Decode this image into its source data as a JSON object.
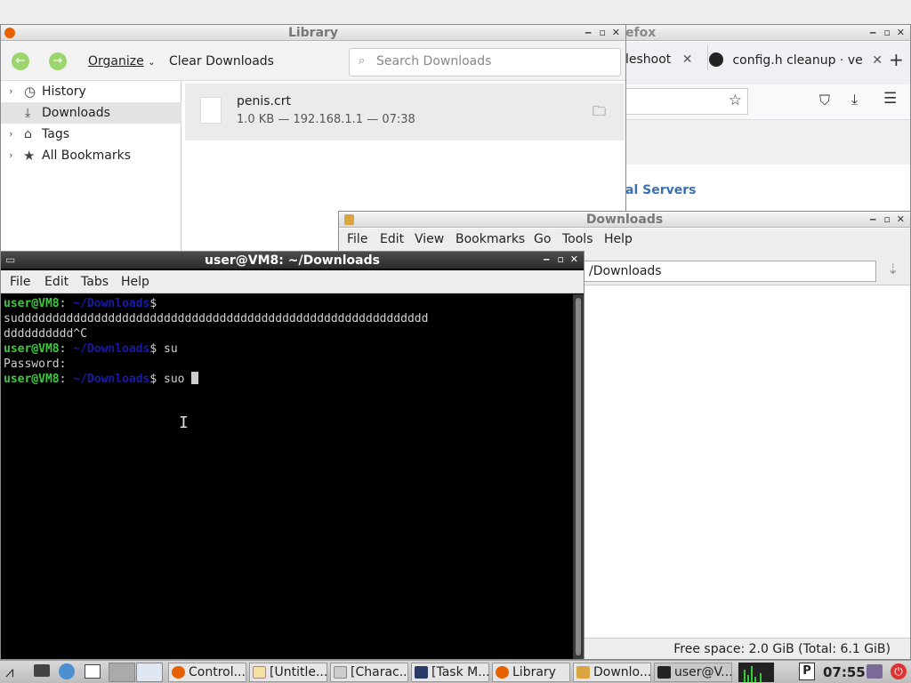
{
  "firefox": {
    "title_fragment": "efox",
    "tab1_label": "leshoot",
    "tab2_label": "config.h cleanup · ve",
    "link_text": "al Servers"
  },
  "library": {
    "title": "Library",
    "organize_label": "Organize",
    "clear_label": "Clear Downloads",
    "search_placeholder": "Search Downloads",
    "sidebar": [
      {
        "label": "History"
      },
      {
        "label": "Downloads"
      },
      {
        "label": "Tags"
      },
      {
        "label": "All Bookmarks"
      }
    ],
    "download": {
      "filename": "penis.crt",
      "details": "1.0 KB — 192.168.1.1 — 07:38"
    }
  },
  "filemanager": {
    "title": "Downloads",
    "menu": [
      "File",
      "Edit",
      "View",
      "Bookmarks",
      "Go",
      "Tools",
      "Help"
    ],
    "path": "/Downloads",
    "status": "Free space: 2.0 GiB (Total: 6.1 GiB)"
  },
  "terminal": {
    "title": "user@VM8: ~/Downloads",
    "menu": [
      "File",
      "Edit",
      "Tabs",
      "Help"
    ],
    "prompt_user": "user@VM8",
    "prompt_sep": ":",
    "prompt_path": " ~/Downloads",
    "prompt_end": "$ ",
    "lines": [
      "suddddddddddddddddddddddddddddddddddddddddddddddddddddddddddd",
      "dddddddddd^C",
      "su",
      "Password:",
      "suo "
    ]
  },
  "taskbar": {
    "tasks": [
      "Control...",
      "[Untitle...",
      "[Charac...",
      "[Task M...",
      "Library",
      "Downlo...",
      "user@V..."
    ],
    "clock": "07:55"
  }
}
